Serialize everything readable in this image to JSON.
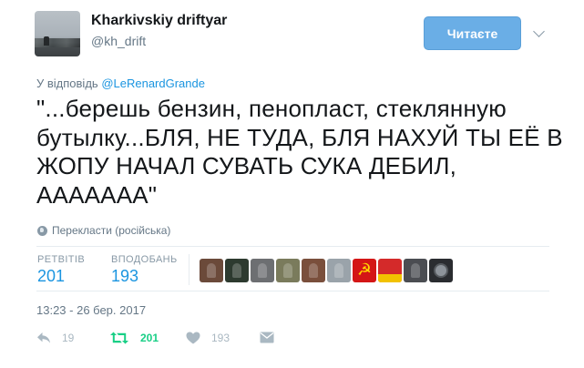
{
  "author": {
    "display_name": "Kharkivskiy driftyar",
    "screen_name": "@kh_drift"
  },
  "follow_button": {
    "label": "Читаєте"
  },
  "reply_context": {
    "prefix": "У відповідь",
    "mention": "@LeRenardGrande"
  },
  "tweet": {
    "text": "\"...берешь бензин, пенопласт, стеклянную бутылку...БЛЯ, НЕ ТУДА, БЛЯ НАХУЙ ТЫ ЕЁ В ЖОПУ НАЧАЛ СУВАТЬ СУКА ДЕБИЛ, ААААААА\"",
    "translate_label": "Перекласти (російська)",
    "timestamp": "13:23 - 26 бер. 2017"
  },
  "stats": {
    "retweets_label": "РЕТВІТІВ",
    "retweets": "201",
    "likes_label": "ВПОДОБАНЬ",
    "likes": "193"
  },
  "liker_avatars": [
    {
      "icon": "liker-avatar-dark-photo",
      "color": "#6b4a3a"
    },
    {
      "icon": "liker-avatar-dark-figure",
      "color": "#2d3a2f"
    },
    {
      "icon": "liker-avatar-grey-photo",
      "color": "#6d6f72"
    },
    {
      "icon": "liker-avatar-soldier",
      "color": "#7a7b5c"
    },
    {
      "icon": "liker-avatar-brown",
      "color": "#7a4f3c"
    },
    {
      "icon": "liker-avatar-portrait",
      "color": "#9aa3aa"
    },
    {
      "icon": "liker-avatar-hammer-sickle",
      "color": "#d41616"
    },
    {
      "icon": "liker-avatar-red-flag",
      "color": "#d42a2a"
    },
    {
      "icon": "liker-avatar-machine",
      "color": "#4b4d52"
    },
    {
      "icon": "liker-avatar-round",
      "color": "#2a2c30"
    }
  ],
  "actions": {
    "replies": "19",
    "retweets": "201",
    "likes": "193"
  },
  "colors": {
    "accent": "#1b95e0",
    "follow_button": "#6aaee6",
    "retweet_active": "#19cf86",
    "muted": "#aab8c2"
  }
}
